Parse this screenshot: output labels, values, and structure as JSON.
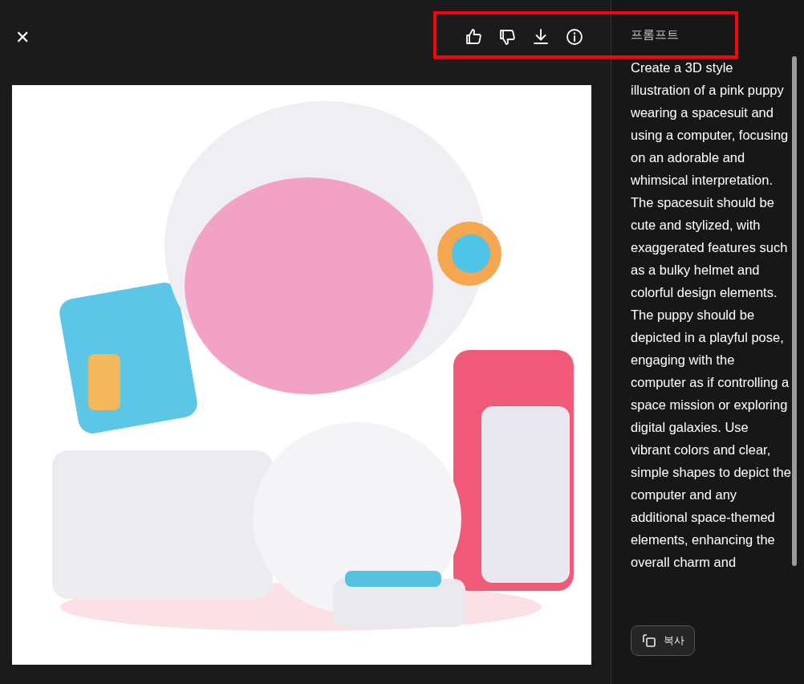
{
  "close_label": "✕",
  "toolbar": {
    "actions": [
      {
        "kind": "like"
      },
      {
        "kind": "dislike"
      },
      {
        "kind": "download"
      },
      {
        "kind": "info"
      }
    ]
  },
  "prompt_panel": {
    "title": "프롬프트",
    "text": "Create a 3D style illustration of a pink puppy wearing a spacesuit and using a computer, focusing on an adorable and whimsical interpretation. The spacesuit should be cute and stylized, with exaggerated features such as a bulky helmet and colorful design elements. The puppy should be depicted in a playful pose, engaging with the computer as if controlling a space mission or exploring digital galaxies. Use vibrant colors and clear, simple shapes to depict the computer and any additional space-themed elements, enhancing the overall charm and",
    "copy_label": "복사"
  }
}
